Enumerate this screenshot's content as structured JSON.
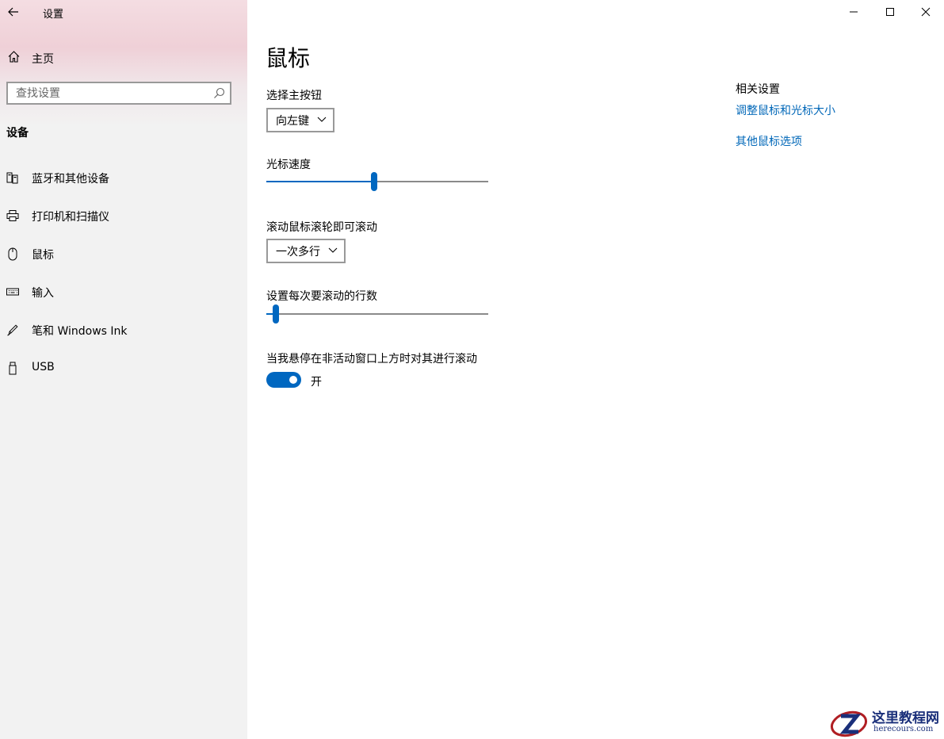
{
  "window": {
    "title": "设置",
    "controls": {
      "minimize": "minimize-icon",
      "maximize": "maximize-icon",
      "close": "close-icon"
    }
  },
  "sidebar": {
    "home_label": "主页",
    "search_placeholder": "查找设置",
    "section_title": "设备",
    "items": [
      {
        "label": "蓝牙和其他设备",
        "icon": "bluetooth-devices-icon"
      },
      {
        "label": "打印机和扫描仪",
        "icon": "printer-icon"
      },
      {
        "label": "鼠标",
        "icon": "mouse-icon",
        "selected": true
      },
      {
        "label": "输入",
        "icon": "keyboard-icon"
      },
      {
        "label": "笔和 Windows Ink",
        "icon": "pen-icon"
      },
      {
        "label": "USB",
        "icon": "usb-icon"
      }
    ]
  },
  "main": {
    "title": "鼠标",
    "primary_button": {
      "label": "选择主按钮",
      "value": "向左键"
    },
    "cursor_speed": {
      "label": "光标速度",
      "value_fraction": 0.47
    },
    "scroll_mode": {
      "label": "滚动鼠标滚轮即可滚动",
      "value": "一次多行"
    },
    "scroll_lines": {
      "label": "设置每次要滚动的行数",
      "value_fraction": 0.03
    },
    "inactive_scroll": {
      "label": "当我悬停在非活动窗口上方时对其进行滚动",
      "state": "开",
      "on": true
    }
  },
  "related": {
    "title": "相关设置",
    "links": [
      "调整鼠标和光标大小",
      "其他鼠标选项"
    ]
  },
  "watermark": {
    "text": "这里教程网",
    "sub": "herecours.com"
  },
  "colors": {
    "accent": "#0067c0",
    "link": "#0067b8",
    "sidebar_bg": "#f2f2f2"
  }
}
